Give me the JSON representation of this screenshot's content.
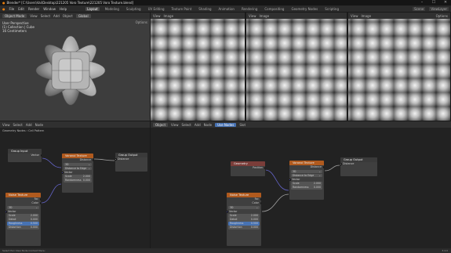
{
  "window": {
    "title": "Blender* [C:\\Users\\Vai\\Desktop\\221205 Voro Texture\\221205 Voro Texture.blend]",
    "minimize": "–",
    "maximize": "☐",
    "close": "✕"
  },
  "menu": {
    "items": [
      "File",
      "Edit",
      "Render",
      "Window",
      "Help"
    ],
    "workspaces": [
      "Layout",
      "Modeling",
      "Sculpting",
      "UV Editing",
      "Texture Paint",
      "Shading",
      "Animation",
      "Rendering",
      "Compositing",
      "Geometry Nodes",
      "Scripting"
    ],
    "active_workspace": "Layout",
    "scene": "Scene",
    "view_layer": "ViewLayer"
  },
  "viewport": {
    "header": [
      "Object Mode",
      "View",
      "Select",
      "Add",
      "Object"
    ],
    "view_label": "Global",
    "options": "Options",
    "info": [
      "User Perspective",
      "(1) Collection | Cube",
      "16 Centimeters"
    ]
  },
  "image_editors": [
    {
      "header": [
        "View",
        "Image"
      ],
      "options": "Options"
    },
    {
      "header": [
        "View",
        "Image"
      ],
      "options": "Options"
    },
    {
      "header": [
        "View",
        "Image"
      ],
      "options": "Options"
    }
  ],
  "node_editor_left": {
    "header": [
      "Object",
      "View",
      "Select",
      "Add",
      "Node"
    ],
    "breadcrumb": [
      "Geometry Nodes",
      "Cell Pattern"
    ],
    "group_input": {
      "title": "Group Input",
      "out": "Vector"
    },
    "voronoi": {
      "title": "Voronoi Texture",
      "out": "Distance",
      "dim": "3D",
      "feature": "Distance to Edge",
      "in_vector": "Vector",
      "scale_label": "Scale",
      "scale_val": "2.000",
      "rand_label": "Randomness",
      "rand_val": "0.000"
    },
    "group_output": {
      "title": "Group Output",
      "in": "Distance"
    },
    "noise": {
      "title": "Noise Texture",
      "outs": [
        "Fac",
        "Color"
      ],
      "dim": "3D",
      "in_vector": "Vector",
      "fields": [
        {
          "label": "Scale",
          "val": "2.000"
        },
        {
          "label": "Detail",
          "val": "0.000"
        },
        {
          "label": "Roughness",
          "val": "0.500"
        },
        {
          "label": "Distortion",
          "val": "0.000"
        }
      ]
    }
  },
  "node_editor_right": {
    "header": [
      "Object",
      "View",
      "Select",
      "Add",
      "Node"
    ],
    "use_nodes": "Use Nodes",
    "slot": "Slot",
    "geometry": {
      "title": "Geometry",
      "out": "Position"
    },
    "noise": {
      "title": "Noise Texture",
      "outs": [
        "Fac",
        "Color"
      ],
      "dim": "3D",
      "in_vector": "Vector",
      "fields": [
        {
          "label": "Scale",
          "val": "2.000"
        },
        {
          "label": "Detail",
          "val": "0.000"
        },
        {
          "label": "Roughness",
          "val": "0.500"
        },
        {
          "label": "Distortion",
          "val": "0.000"
        }
      ]
    },
    "voronoi": {
      "title": "Voronoi Texture",
      "out": "Distance",
      "dim": "3D",
      "feature": "Distance to Edge",
      "in_vector": "Vector",
      "scale_label": "Scale",
      "scale_val": "2.000",
      "rand_label": "Randomness",
      "rand_val": "0.000"
    },
    "group_output": {
      "title": "Group Output",
      "in": "Distance"
    }
  },
  "status": "Select   Pan View   Node Context Menu",
  "version": "3.4.0",
  "colors": {
    "input_header": "#7a3d39",
    "texture_header": "#b05a1e",
    "output_header": "#3a3a3a",
    "accent": "#4772b3"
  }
}
